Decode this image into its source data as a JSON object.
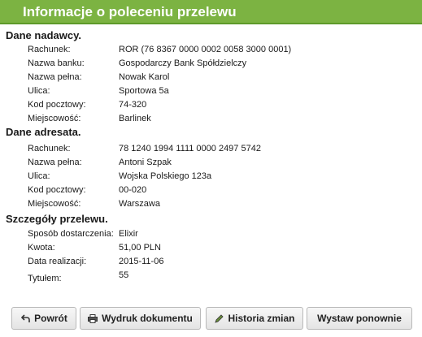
{
  "header": {
    "title": "Informacje o poleceniu przelewu"
  },
  "sender": {
    "title": "Dane nadawcy.",
    "rows": [
      {
        "label": "Rachunek:",
        "value": "ROR (76 8367 0000 0002 0058 3000 0001)"
      },
      {
        "label": "Nazwa banku:",
        "value": "Gospodarczy Bank Spółdzielczy"
      },
      {
        "label": "Nazwa pełna:",
        "value": "Nowak Karol"
      },
      {
        "label": "Ulica:",
        "value": "Sportowa 5a"
      },
      {
        "label": "Kod pocztowy:",
        "value": "74-320"
      },
      {
        "label": "Miejscowość:",
        "value": "Barlinek"
      }
    ]
  },
  "recipient": {
    "title": "Dane adresata.",
    "rows": [
      {
        "label": "Rachunek:",
        "value": "78 1240 1994 1111 0000 2497 5742"
      },
      {
        "label": "Nazwa pełna:",
        "value": "Antoni Szpak"
      },
      {
        "label": "Ulica:",
        "value": "Wojska Polskiego 123a"
      },
      {
        "label": "Kod pocztowy:",
        "value": "00-020"
      },
      {
        "label": "Miejscowość:",
        "value": "Warszawa"
      }
    ]
  },
  "details": {
    "title": "Szczegóły przelewu.",
    "rows": [
      {
        "label": "Sposób dostarczenia:",
        "value": "Elixir"
      },
      {
        "label": "Kwota:",
        "value": "51,00 PLN"
      },
      {
        "label": "Data realizacji:",
        "value": "2015-11-06"
      },
      {
        "label": "Tytułem:",
        "value": "55"
      }
    ]
  },
  "buttons": {
    "back": {
      "label": "Powrót",
      "icon": "back-arrow-icon"
    },
    "print": {
      "label": "Wydruk dokumentu",
      "icon": "printer-icon"
    },
    "history": {
      "label": "Historia zmian",
      "icon": "pencil-icon"
    },
    "resend": {
      "label": "Wystaw ponownie"
    }
  }
}
